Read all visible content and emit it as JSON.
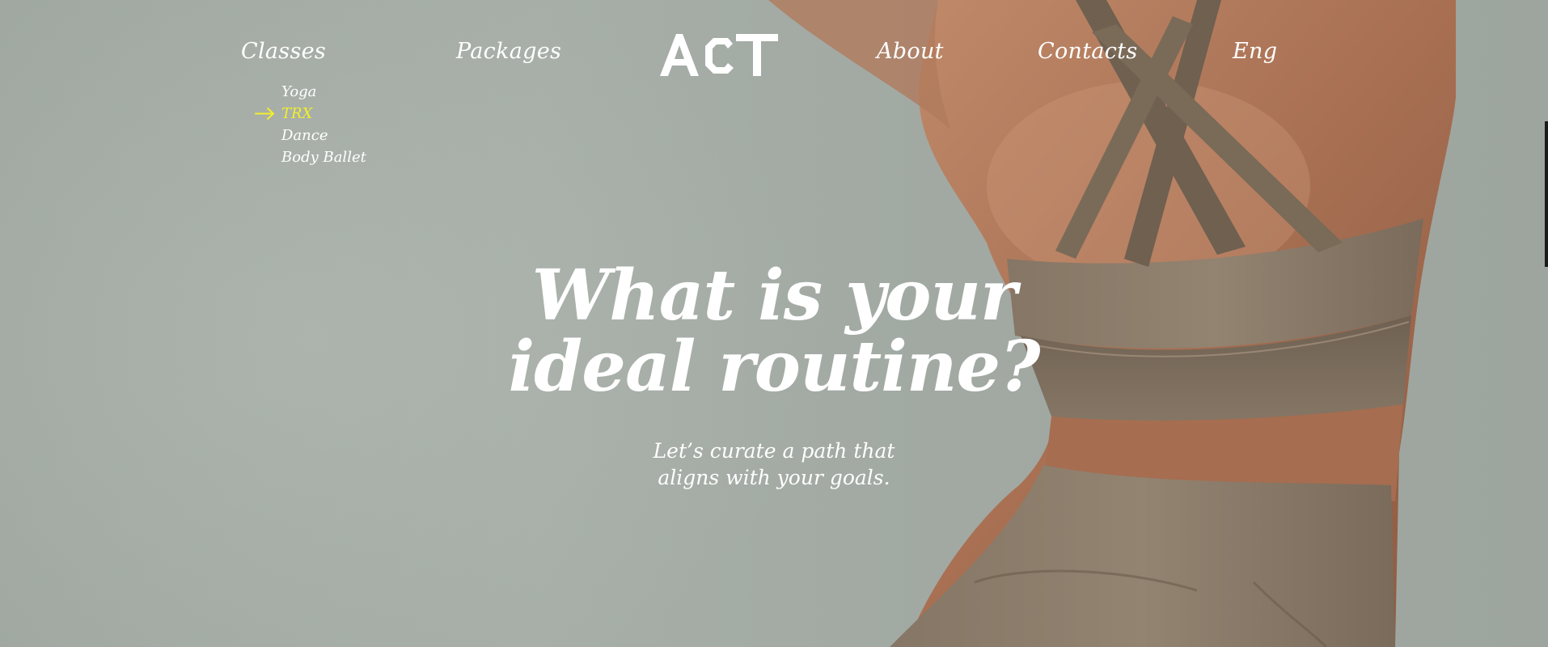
{
  "brand": {
    "logo_text": "ACT"
  },
  "nav": {
    "classes": "Classes",
    "packages": "Packages",
    "about": "About",
    "contacts": "Contacts",
    "language": "Eng"
  },
  "submenu": {
    "items": [
      {
        "label": "Yoga",
        "active": false
      },
      {
        "label": "TRX",
        "active": true
      },
      {
        "label": "Dance",
        "active": false
      },
      {
        "label": "Body Ballet",
        "active": false
      }
    ],
    "active_icon": "arrow-right-icon"
  },
  "hero": {
    "headline_line1": "What is your",
    "headline_line2": "ideal routine?",
    "subline_line1": "Let’s curate a path that",
    "subline_line2": "aligns with your goals."
  },
  "colors": {
    "text": "#ffffff",
    "accent": "#f2ef2a",
    "background": "#a3aaa4"
  }
}
